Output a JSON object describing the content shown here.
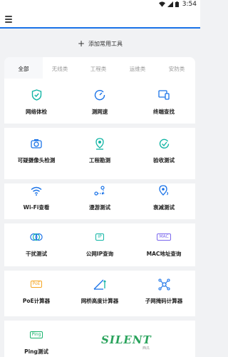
{
  "statusbar": {
    "time": "3:54"
  },
  "toolbar": {
    "add_label": "添加常用工具"
  },
  "tabs": [
    "全部",
    "无线类",
    "工程类",
    "运维类",
    "安防类"
  ],
  "tools": [
    {
      "label": "网络体检",
      "icon": "shield-check-icon"
    },
    {
      "label": "测网速",
      "icon": "speedometer-icon"
    },
    {
      "label": "终端查找",
      "icon": "devices-icon"
    },
    {
      "label": "可疑摄像头检测",
      "icon": "camera-icon"
    },
    {
      "label": "工程勘测",
      "icon": "map-pin-icon"
    },
    {
      "label": "验收测试",
      "icon": "check-circle-icon"
    },
    {
      "label": "Wi-Fi查看",
      "icon": "wifi-icon"
    },
    {
      "label": "漫游测试",
      "icon": "roaming-icon"
    },
    {
      "label": "衰减测试",
      "icon": "location-pin-icon"
    },
    {
      "label": "干扰测试",
      "icon": "interference-icon",
      "badge": ""
    },
    {
      "label": "公网IP查询",
      "icon": "ip-icon",
      "badge": "IP"
    },
    {
      "label": "MAC地址查询",
      "icon": "mac-icon",
      "badge": "MAC"
    },
    {
      "label": "PoE计算器",
      "icon": "poe-icon",
      "badge": "PoE"
    },
    {
      "label": "网桥高度计算器",
      "icon": "bridge-height-icon"
    },
    {
      "label": "子网掩码计算器",
      "icon": "subnet-icon"
    },
    {
      "label": "Ping测试",
      "icon": "ping-icon",
      "badge": "Ping"
    }
  ],
  "watermark": {
    "text": "SILENT",
    "sub": "西瓜"
  },
  "colors": {
    "accent": "#1a73e8",
    "teal": "#12b5a5",
    "purple": "#7b68ee",
    "orange": "#f5a623",
    "green": "#18b36c"
  }
}
